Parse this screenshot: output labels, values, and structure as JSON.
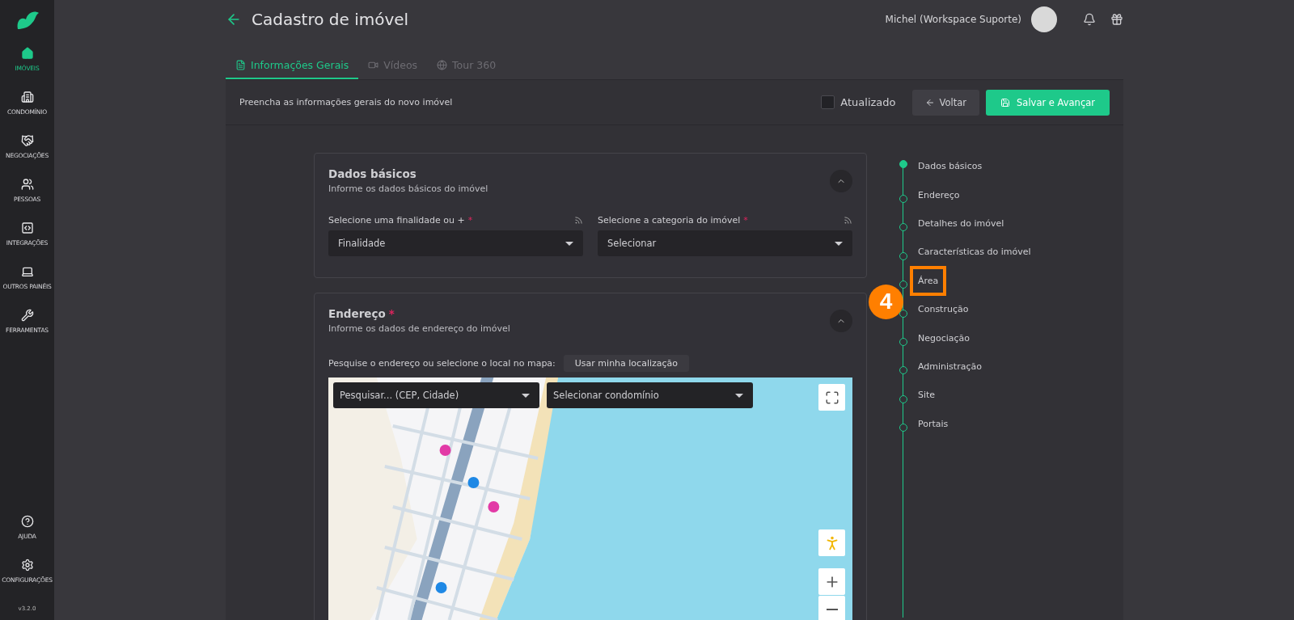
{
  "sidebar": {
    "items": [
      {
        "label": "IMÓVEIS",
        "selected": true
      },
      {
        "label": "CONDOMÍNIO",
        "selected": false
      },
      {
        "label": "NEGOCIAÇÕES",
        "selected": false
      },
      {
        "label": "PESSOAS",
        "selected": false
      },
      {
        "label": "INTEGRAÇÕES",
        "selected": false
      },
      {
        "label": "OUTROS PAINÉIS",
        "selected": false
      },
      {
        "label": "FERRAMENTAS",
        "selected": false
      }
    ],
    "bottom_items": [
      {
        "label": "AJUDA"
      },
      {
        "label": "CONFIGURAÇÕES"
      }
    ],
    "version": "v3.2.0"
  },
  "header": {
    "title": "Cadastro de imóvel",
    "user": "Michel (Workspace Suporte)"
  },
  "tabs": [
    {
      "label": "Informações Gerais",
      "selected": true
    },
    {
      "label": "Vídeos",
      "selected": false
    },
    {
      "label": "Tour 360",
      "selected": false
    }
  ],
  "toolbar": {
    "description": "Preencha as informações gerais do novo imóvel",
    "checkbox": {
      "label": "Atualizado",
      "checked": false
    },
    "back_button": "Voltar",
    "save_button": "Salvar e Avançar"
  },
  "sections": [
    {
      "kind": "fields",
      "title": "Dados básicos",
      "required": false,
      "subtitle": "Informe os dados básicos do imóvel",
      "expanded": true,
      "fields": [
        {
          "label": "Selecione uma finalidade ou +",
          "required": true,
          "placeholder": "Finalidade"
        },
        {
          "label": "Selecione a categoria do imóvel",
          "required": true,
          "placeholder": "Selecionar"
        }
      ]
    },
    {
      "kind": "map",
      "title": "Endereço",
      "required": true,
      "subtitle": "Informe os dados de endereço do imóvel",
      "expanded": true,
      "prompt": "Pesquise o endereço ou selecione o local no mapa:",
      "location_button": "Usar minha localização",
      "map": {
        "kind": "picture",
        "search_placeholder": "Pesquisar... (CEP, Cidade)",
        "condo_placeholder": "Selecionar condomínio"
      }
    }
  ],
  "steps": [
    {
      "label": "Dados básicos",
      "selected": true,
      "highlighted": false
    },
    {
      "label": "Endereço",
      "selected": false,
      "highlighted": false
    },
    {
      "label": "Detalhes do imóvel",
      "selected": false,
      "highlighted": false
    },
    {
      "label": "Características do imóvel",
      "selected": false,
      "highlighted": false
    },
    {
      "label": "Área",
      "selected": false,
      "highlighted": true
    },
    {
      "label": "Construção",
      "selected": false,
      "highlighted": false
    },
    {
      "label": "Negociação",
      "selected": false,
      "highlighted": false
    },
    {
      "label": "Administração",
      "selected": false,
      "highlighted": false
    },
    {
      "label": "Site",
      "selected": false,
      "highlighted": false
    },
    {
      "label": "Portais",
      "selected": false,
      "highlighted": false
    }
  ],
  "callout": {
    "label": "4"
  },
  "required_mark": "*"
}
